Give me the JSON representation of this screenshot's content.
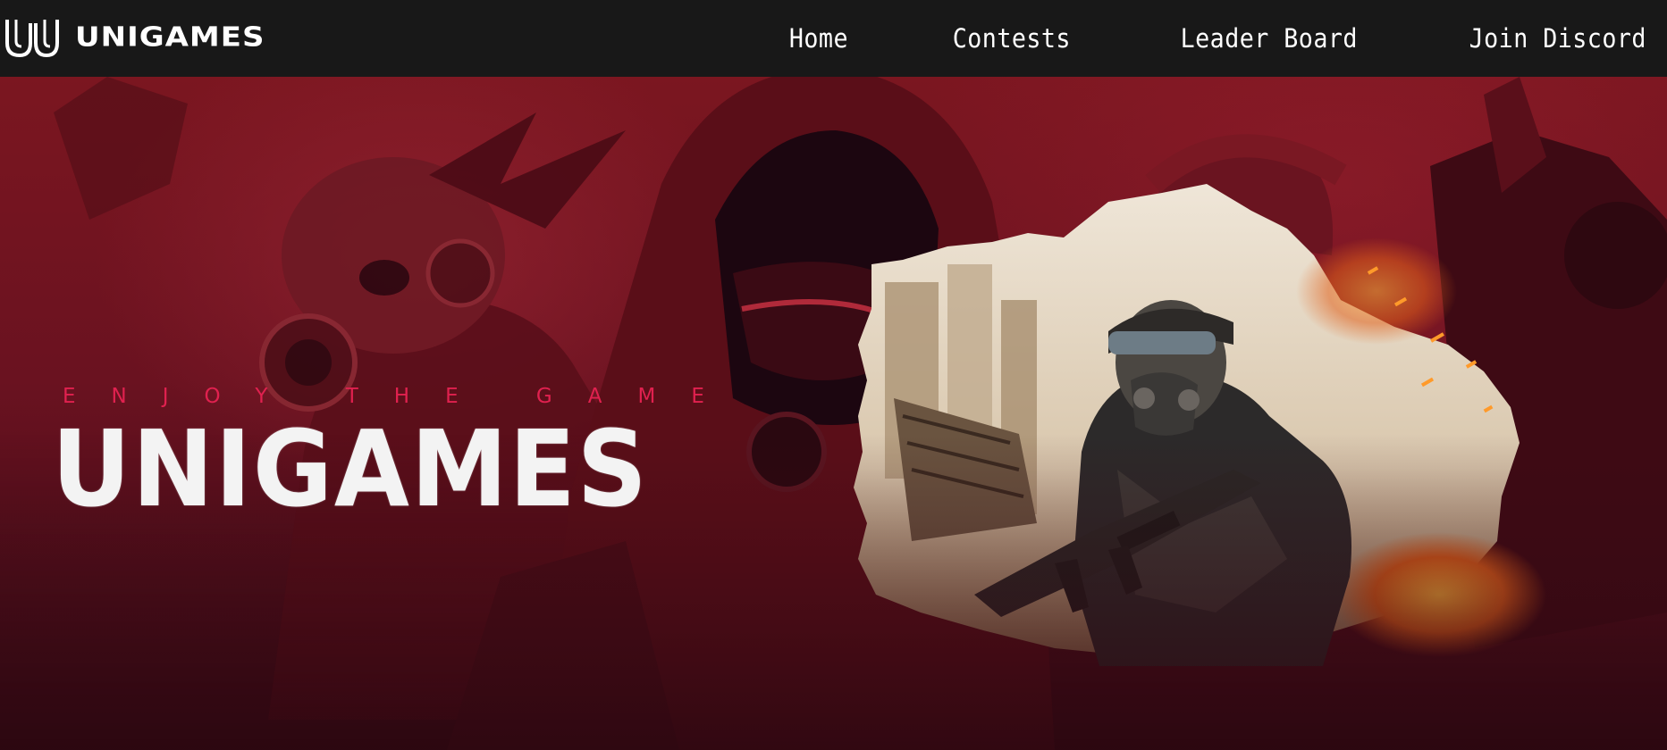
{
  "brand": {
    "name": "UNIGAMES",
    "icon": "uu-logo-icon"
  },
  "nav": {
    "items": [
      {
        "label": "Home"
      },
      {
        "label": "Contests"
      },
      {
        "label": "Leader Board"
      },
      {
        "label": "Join Discord"
      }
    ]
  },
  "hero": {
    "tagline": "ENJOY THE GAME",
    "title": "UNIGAMES"
  },
  "colors": {
    "navbar": "#181818",
    "hero_red": "#7b1620",
    "accent": "#e0214f",
    "text": "#ffffff"
  }
}
